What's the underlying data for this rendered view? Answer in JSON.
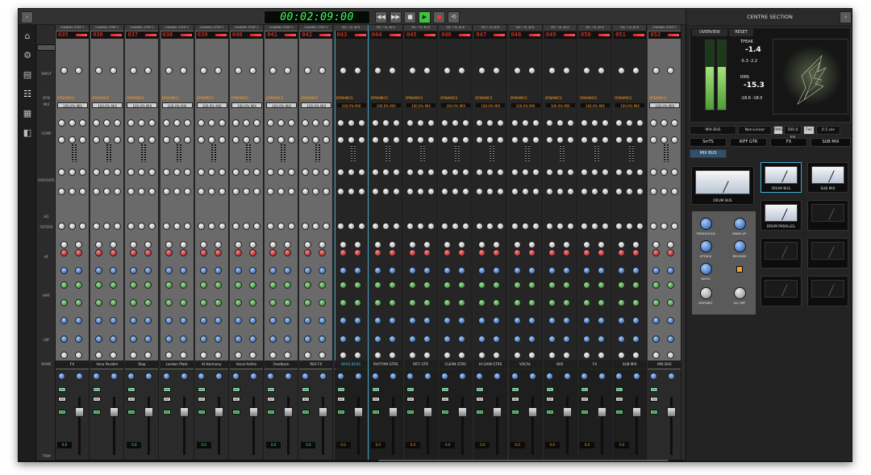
{
  "timecode": "00:02:09:00",
  "centre_title": "CENTRE SECTION",
  "rows": {
    "input": "INPUT",
    "dyn": "DYN",
    "mix": "MIX",
    "comp": "COMP",
    "exp": "EXP/GATE",
    "eq": "EQ",
    "filters": "FILTERS",
    "hf": "HF",
    "hmf": "HMF",
    "lmf": "LMF",
    "lf": "LF",
    "name": "NAME",
    "trim": "TRIM"
  },
  "strips": [
    {
      "header": "CHANNEL STRIP 1",
      "num": "035",
      "name": "FX",
      "trim": "0.0",
      "style": "light"
    },
    {
      "header": "CHANNEL STRIP 2",
      "num": "036",
      "name": "Voca Parallel",
      "trim": "",
      "style": "light"
    },
    {
      "header": "CHANNEL STRIP 2",
      "num": "037",
      "name": "Slap",
      "trim": "0.0",
      "style": "light"
    },
    {
      "header": "CHANNEL STRIP 2",
      "num": "038",
      "name": "London Plate",
      "trim": "",
      "style": "light"
    },
    {
      "header": "CHANNEL STRIP 2",
      "num": "039",
      "name": "Al Harmony",
      "trim": "0.0",
      "style": "light"
    },
    {
      "header": "CHANNEL STRIP 2",
      "num": "040",
      "name": "Vocal Aahhs",
      "trim": "",
      "style": "light"
    },
    {
      "header": "CHANNEL STRIP 2",
      "num": "041",
      "name": "Feedback",
      "trim": "0.0",
      "style": "light"
    },
    {
      "header": "CHANNEL STRIP 2",
      "num": "042",
      "name": "REV FX",
      "trim": "0.0",
      "style": "light"
    },
    {
      "header": "SSL • SL 4K B",
      "num": "043",
      "name": "BASS BUSS",
      "trim": "0.0",
      "style": "dark",
      "selected": true
    },
    {
      "header": "SSL • SL 4K B",
      "num": "044",
      "name": "RHYTHM GTRS",
      "trim": "0.0",
      "style": "dark"
    },
    {
      "header": "SSL • SL 4K B",
      "num": "045",
      "name": "RIFF GTR",
      "trim": "0.0",
      "style": "dark"
    },
    {
      "header": "SSL • SL 4K B",
      "num": "046",
      "name": "CLEAN GTRS",
      "trim": "0.0",
      "style": "dark"
    },
    {
      "header": "SSL • SL 4K B",
      "num": "047",
      "name": "HI GAIN GTRS",
      "trim": "0.0",
      "style": "dark"
    },
    {
      "header": "SSL • SL 4K B",
      "num": "048",
      "name": "VOCAL",
      "trim": "0.0",
      "style": "dark"
    },
    {
      "header": "SSL • SL 4K B",
      "num": "049",
      "name": "BVS",
      "trim": "0.0",
      "style": "dark"
    },
    {
      "header": "SSL • SL 4K B",
      "num": "050",
      "name": "FX",
      "trim": "0.0",
      "style": "dark"
    },
    {
      "header": "SSL • SL 4K B",
      "num": "051",
      "name": "SUB MIX",
      "trim": "0.0",
      "style": "dark"
    },
    {
      "header": "CHANNEL STRIP 2",
      "num": "052",
      "name": "MIX BUS",
      "trim": "",
      "style": "light"
    }
  ],
  "labels": {
    "dynamics": "DYNAMICS",
    "mix_pct": "100.0% MIX",
    "solo": "SOLO",
    "cut": "CUT",
    "safe": "SAFE"
  },
  "centre": {
    "overview": "OVERVIEW",
    "reset": "RESET",
    "tpeak_label": "TPEAK",
    "tpeak_val": "-1.4",
    "lr_vals": "-5.3  -2.2",
    "rms_label": "RMS",
    "rms_val": "-15.3",
    "rms_lr": "-18.6  -18.0",
    "mix_bus": "MIX BUS",
    "nonlinear": "Non-Linear",
    "rms": "RMS",
    "rms_ms": "500.0 ms",
    "fall": "Fall",
    "fall_val": "0.5 sec",
    "tabs": [
      "SrrTS",
      "RIFF GTR",
      "FX",
      "SUB MIX"
    ],
    "tab_selected": "MIX BUS",
    "buses": [
      "DRUM BUS",
      "DRUM BUS",
      "SUB MIX",
      "DRUM PARALLEL"
    ],
    "comp_labels": [
      "THRESHOLD",
      "MAKE-UP",
      "ATTACK",
      "RELEASE",
      "RATIO",
      "DRY/WET",
      "S/C HPF"
    ]
  },
  "colors": {
    "accent": "#3fa5c6",
    "lcd": "#3dff5a",
    "num": "#ff3a2a",
    "orange": "#ff9f2a"
  }
}
